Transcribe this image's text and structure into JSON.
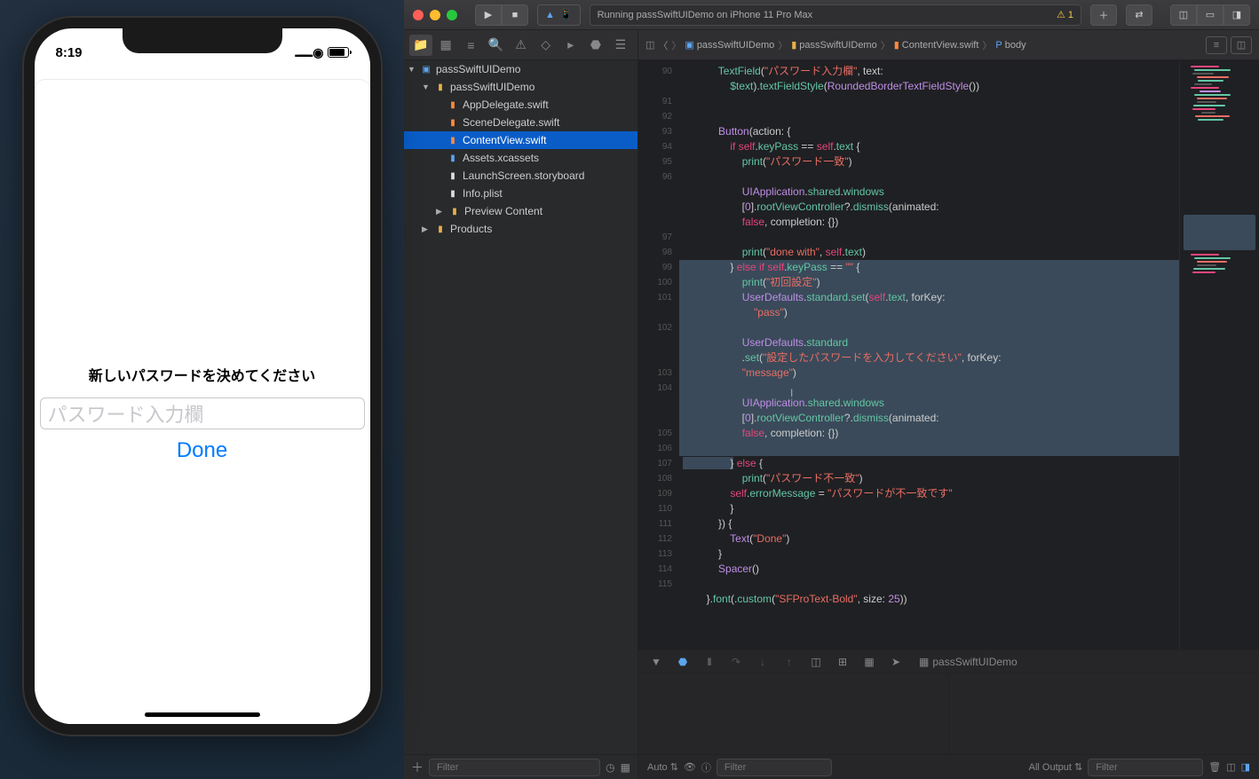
{
  "simulator": {
    "time": "8:19",
    "prompt": "新しいパスワードを決めてください",
    "placeholder": "パスワード入力欄",
    "done": "Done"
  },
  "titlebar": {
    "running_text": "Running passSwiftUIDemo on iPhone 11 Pro Max",
    "warning_count": "1"
  },
  "jumpbar": {
    "proj": "passSwiftUIDemo",
    "folder": "passSwiftUIDemo",
    "file": "ContentView.swift",
    "symbol": "body"
  },
  "navigator": {
    "root": "passSwiftUIDemo",
    "group": "passSwiftUIDemo",
    "files": {
      "appdelegate": "AppDelegate.swift",
      "scenedelegate": "SceneDelegate.swift",
      "contentview": "ContentView.swift",
      "assets": "Assets.xcassets",
      "launchscreen": "LaunchScreen.storyboard",
      "infoplist": "Info.plist"
    },
    "preview": "Preview Content",
    "products": "Products",
    "filter_placeholder": "Filter"
  },
  "code": {
    "lines": [
      "90",
      "91",
      "92",
      "93",
      "94",
      "95",
      "96",
      "",
      "97",
      "98",
      "99",
      "100",
      "101",
      "",
      "102",
      "",
      "",
      "103",
      "104",
      "",
      "",
      "105",
      "106",
      "107",
      "108",
      "109",
      "110",
      "111",
      "112",
      "113",
      "114",
      "115"
    ]
  },
  "debug": {
    "target": "passSwiftUIDemo",
    "auto": "Auto",
    "filter": "Filter",
    "all_output": "All Output"
  }
}
